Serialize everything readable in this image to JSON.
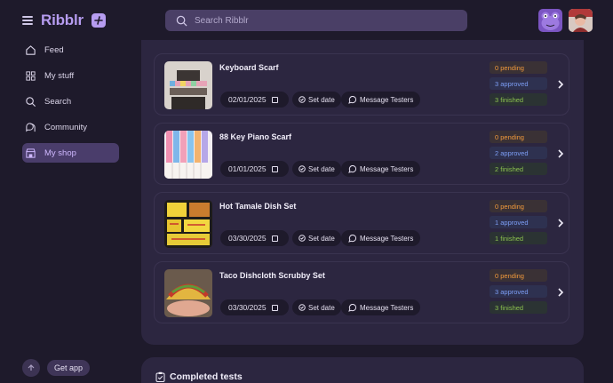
{
  "app": {
    "name": "Ribblr"
  },
  "search": {
    "placeholder": "Search Ribblr"
  },
  "nav": [
    {
      "label": "Feed",
      "icon": "home-icon"
    },
    {
      "label": "My stuff",
      "icon": "grid-icon"
    },
    {
      "label": "Search",
      "icon": "search-icon"
    },
    {
      "label": "Community",
      "icon": "chat-bubbles-icon"
    },
    {
      "label": "My shop",
      "icon": "shop-icon",
      "active": true
    }
  ],
  "footer": {
    "get_app": "Get app"
  },
  "colors": {
    "accent": "#b69cf0",
    "pending": "#f29a3c",
    "approved": "#7d9ef5",
    "finished": "#8cc24f"
  },
  "tests": [
    {
      "title": "Keyboard Scarf",
      "date": "02/01/2025",
      "set_date": "Set date",
      "message": "Message Testers",
      "pending": "0 pending",
      "approved": "3 approved",
      "finished": "3 finished"
    },
    {
      "title": "88 Key Piano Scarf",
      "date": "01/01/2025",
      "set_date": "Set date",
      "message": "Message Testers",
      "pending": "0 pending",
      "approved": "2 approved",
      "finished": "2 finished"
    },
    {
      "title": "Hot Tamale Dish Set",
      "date": "03/30/2025",
      "set_date": "Set date",
      "message": "Message Testers",
      "pending": "0 pending",
      "approved": "1 approved",
      "finished": "1 finished"
    },
    {
      "title": "Taco Dishcloth Scrubby Set",
      "date": "03/30/2025",
      "set_date": "Set date",
      "message": "Message Testers",
      "pending": "0 pending",
      "approved": "3 approved",
      "finished": "3 finished"
    }
  ],
  "completed": {
    "label": "Completed tests"
  }
}
